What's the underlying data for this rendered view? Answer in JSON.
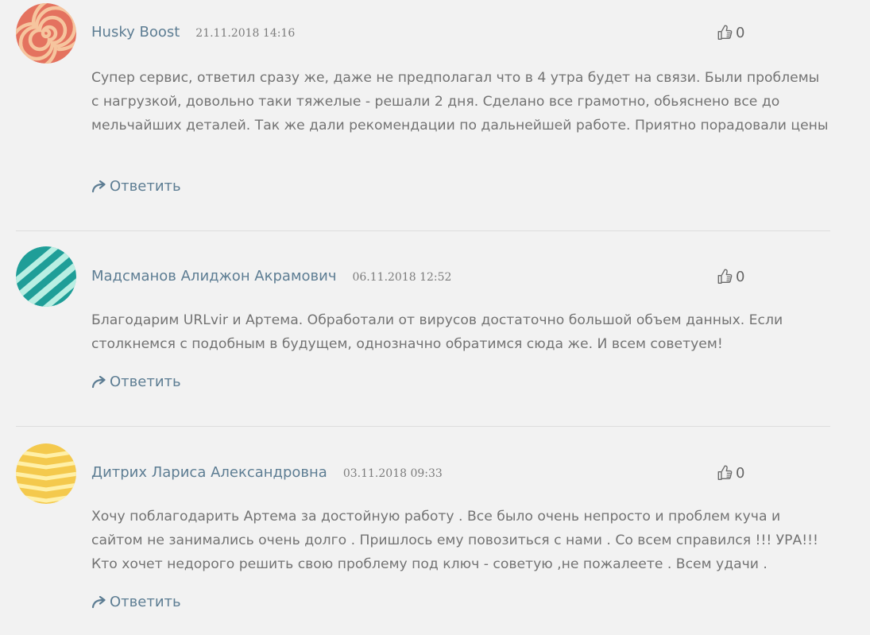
{
  "comments": [
    {
      "author": "Husky Boost",
      "date": "21.11.2018 14:16",
      "likes": "0",
      "text": "Супер сервис, ответил сразу же, даже не предполагал что в 4 утра будет на связи. Были проблемы с нагрузкой, довольно таки тяжелые - решали 2 дня. Сделано все грамотно, обьяснено все до мельчайших деталей. Так же дали рекомендации по дальнейшей работе. Приятно порадовали цены",
      "reply_label": "Ответить",
      "avatar_colors": [
        "#e4725f",
        "#f6c59e"
      ]
    },
    {
      "author": "Мадсманов Алиджон Акрамович",
      "date": "06.11.2018 12:52",
      "likes": "0",
      "text": "Благодарим URLvir и Артема. Обработали от вирусов достаточно большой объем данных. Если столкнемся с подобным в будущем, однозначно обратимся сюда же. И всем советуем!",
      "reply_label": "Ответить",
      "avatar_colors": [
        "#1f9e98",
        "#b9efe3"
      ]
    },
    {
      "author": "Дитрих Лариса Александровна",
      "date": "03.11.2018 09:33",
      "likes": "0",
      "text": "Хочу поблагодарить Артема за достойную работу . Все было очень непросто и проблем куча и сайтом не занимались очень долго . Пришлось ему повозиться с нами . Со всем справился !!! УРА!!! Кто хочет недорого решить свою проблему под ключ - советую ,не пожалеете . Всем удачи .",
      "reply_label": "Ответить",
      "avatar_colors": [
        "#f4c94d",
        "#fff0a8"
      ]
    }
  ],
  "colors": {
    "background": "#f2f2f2",
    "author": "#5d7d93",
    "text": "#737373",
    "divider": "#dddddd"
  },
  "icons": {
    "like": "thumbs-up-icon",
    "reply": "reply-arrow-icon"
  }
}
